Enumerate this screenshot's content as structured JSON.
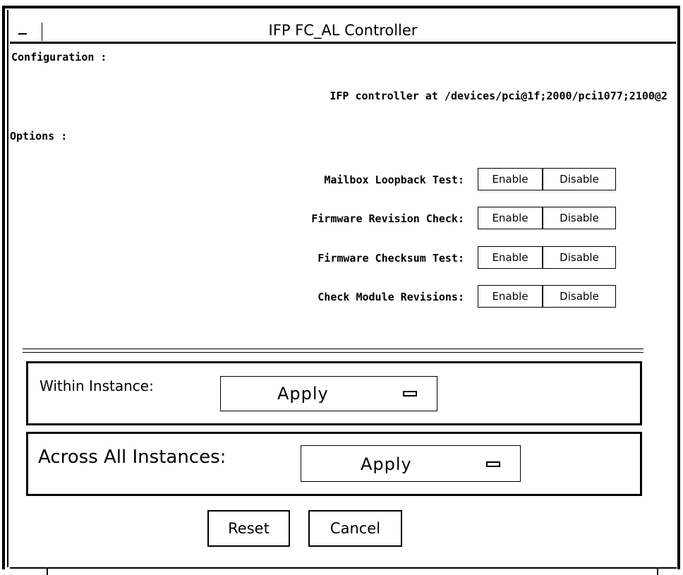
{
  "window": {
    "title": "IFP FC_AL Controller"
  },
  "configuration": {
    "heading": "Configuration :",
    "controller_text": "IFP controller at /devices/pci@1f;2000/pci1077;2100@2"
  },
  "options": {
    "heading": "Options :",
    "rows": [
      {
        "label": "Mailbox Loopback Test:",
        "enable": "Enable",
        "disable": "Disable"
      },
      {
        "label": "Firmware Revision Check:",
        "enable": "Enable",
        "disable": "Disable"
      },
      {
        "label": "Firmware Checksum Test:",
        "enable": "Enable",
        "disable": "Disable"
      },
      {
        "label": "Check Module Revisions:",
        "enable": "Enable",
        "disable": "Disable"
      }
    ]
  },
  "within_instance": {
    "label": "Within Instance:",
    "value": "Apply"
  },
  "across_instances": {
    "label": "Across All Instances:",
    "value": "Apply"
  },
  "buttons": {
    "reset": "Reset",
    "cancel": "Cancel"
  }
}
